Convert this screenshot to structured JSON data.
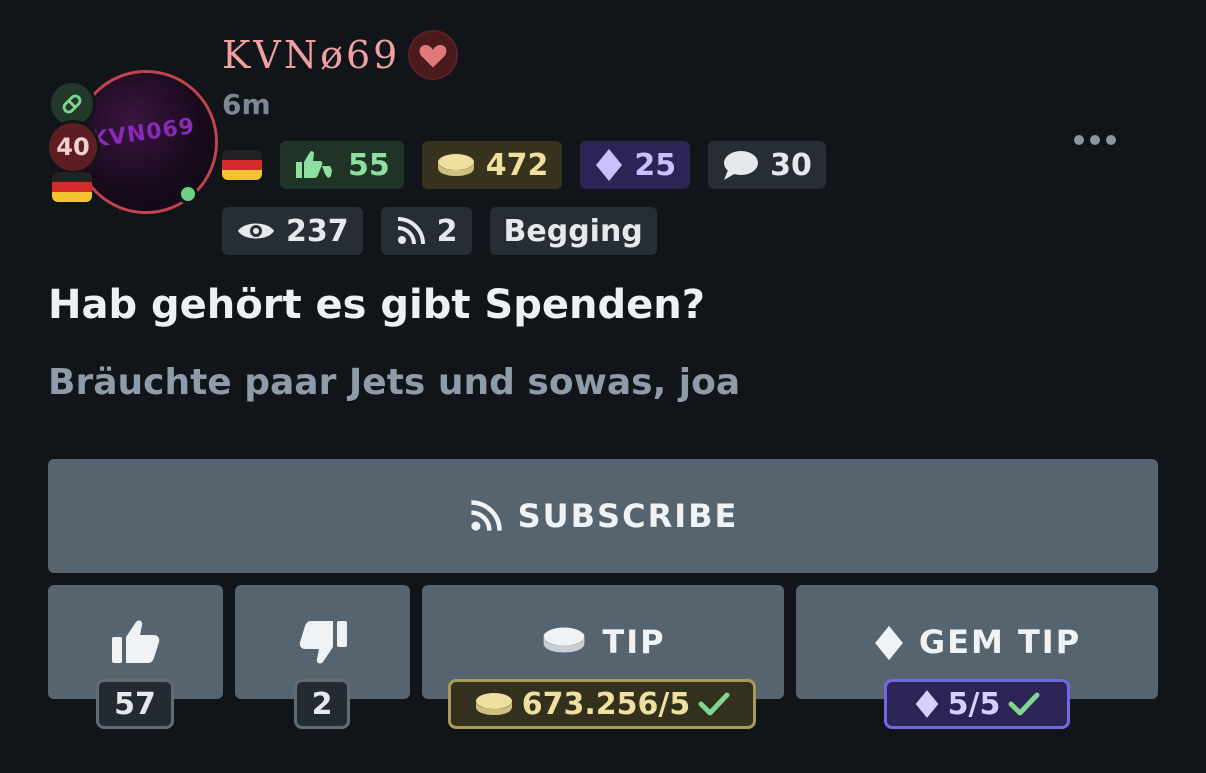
{
  "post": {
    "username": "KVNø69",
    "time": "6m",
    "title": "Hab gehört es gibt Spenden?",
    "body": "Bräuchte paar Jets und sowas, joa",
    "avatar_text": "KVN069",
    "level": "40"
  },
  "stats": {
    "reputation": "55",
    "coins": "472",
    "gems": "25",
    "comments": "30",
    "views": "237",
    "subscribers": "2",
    "category": "Begging"
  },
  "actions": {
    "subscribe_label": "SUBSCRIBE",
    "like_count": "57",
    "dislike_count": "2",
    "tip_label": "TIP",
    "tip_total": "673.256/5",
    "gem_tip_label": "GEM TIP",
    "gem_tip_total": "5/5"
  },
  "colors": {
    "background": "#111418",
    "button": "#566470",
    "username": "#f0a0a0",
    "green": "#8de0a0",
    "gold": "#f0e0a0",
    "purple": "#2c2454"
  }
}
